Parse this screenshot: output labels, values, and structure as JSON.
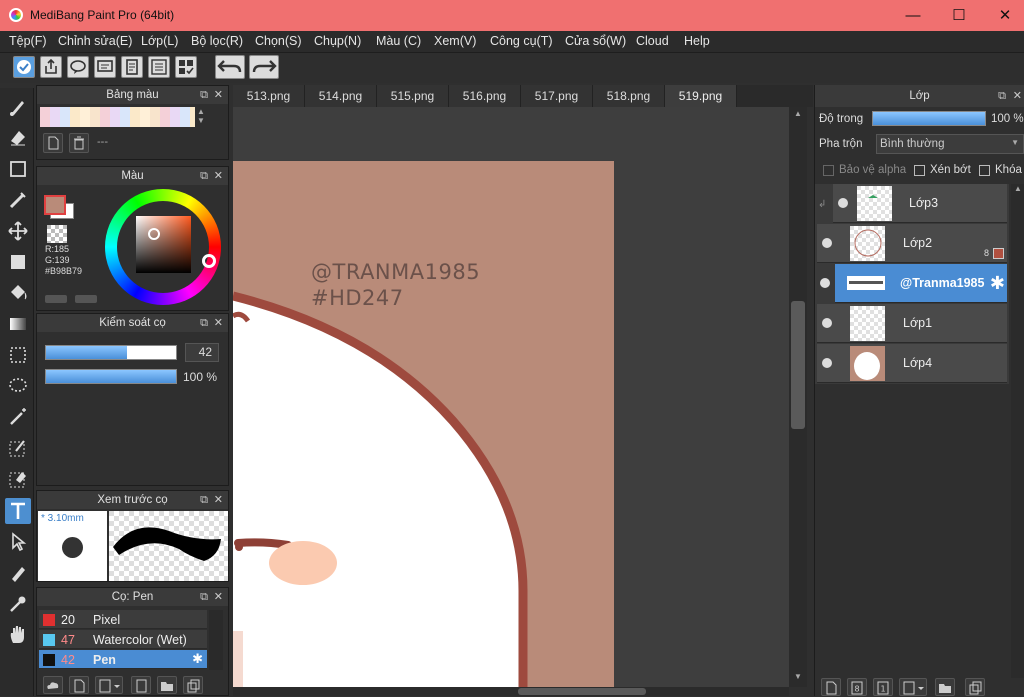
{
  "window": {
    "title": "MediBang Paint Pro (64bit)",
    "minimize": "—",
    "maximize": "☐",
    "close": "✕"
  },
  "menu": [
    "Tệp(F)",
    "Chỉnh sửa(E)",
    "Lớp(L)",
    "Bộ lọc(R)",
    "Chọn(S)",
    "Chụp(N)",
    "Màu (C)",
    "Xem(V)",
    "Công cụ(T)",
    "Cửa sổ(W)",
    "Cloud",
    "Help"
  ],
  "tabs": [
    "513.png",
    "514.png",
    "515.png",
    "516.png",
    "517.png",
    "518.png",
    "519.png"
  ],
  "active_tab": "519.png",
  "palette": {
    "title": "Bảng màu",
    "name": "---"
  },
  "color": {
    "title": "Màu",
    "r": "R:185",
    "g": "G:139",
    "hex": "#B98B79",
    "current": "#B98B79"
  },
  "brush_control": {
    "title": "Kiểm soát cọ",
    "size": "42",
    "opacity": "100 %",
    "size_fraction": 0.62,
    "opacity_fraction": 1.0
  },
  "brush_preview": {
    "title": "Xem trước cọ",
    "size": "* 3.10mm"
  },
  "brush_list": {
    "title": "Cọ: Pen",
    "items": [
      {
        "size": "20",
        "name": "Pixel",
        "color": "#e03030"
      },
      {
        "size": "47",
        "name": "Watercolor (Wet)",
        "color": "#58c8f0"
      },
      {
        "size": "42",
        "name": "Pen",
        "color": "#111111"
      }
    ]
  },
  "canvas_text": {
    "line1": "@TRANMA1985",
    "line2": "#HD247"
  },
  "layers": {
    "title": "Lớp",
    "opacity_label": "Độ trong",
    "opacity_value": "100 %",
    "blend_label": "Pha trộn",
    "blend_value": "Bình thường",
    "protect_alpha": "Bảo vệ alpha",
    "clip": "Xén bớt",
    "lock": "Khóa",
    "items": [
      {
        "name": "Lớp3"
      },
      {
        "name": "Lớp2",
        "badge": "8"
      },
      {
        "name": "@Tranma1985"
      },
      {
        "name": "Lớp1"
      },
      {
        "name": "Lớp4"
      }
    ]
  }
}
